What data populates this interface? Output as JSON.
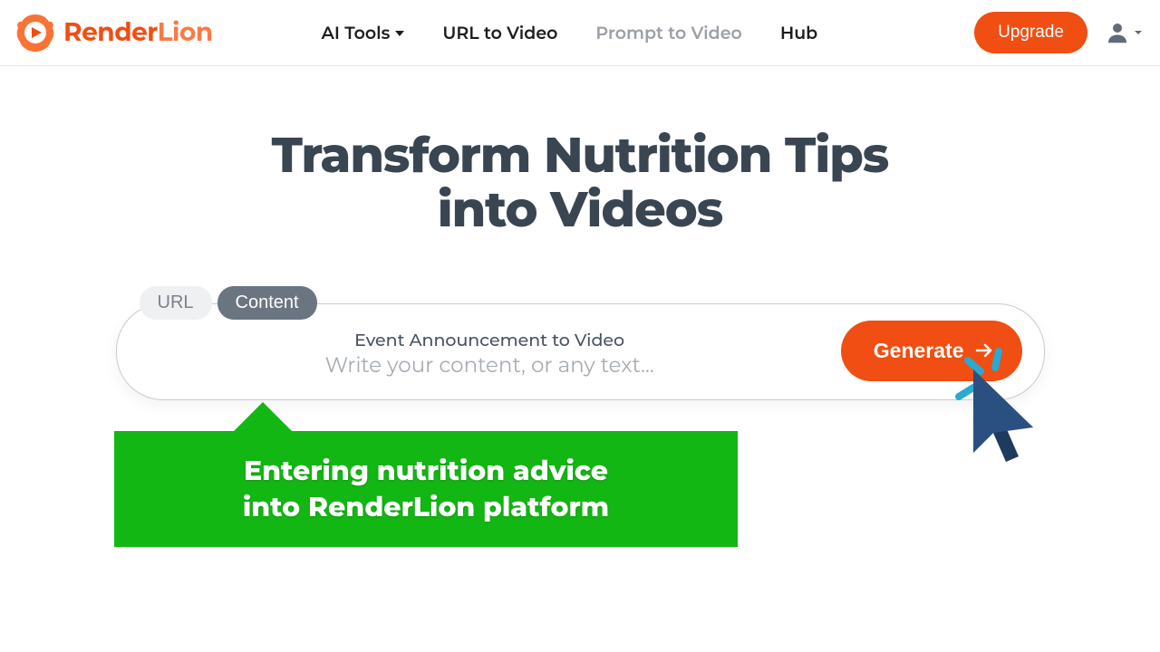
{
  "brand": {
    "name_a": "Render",
    "name_b": "Lion"
  },
  "nav": {
    "ai_tools": "AI Tools",
    "url_to_video": "URL to Video",
    "prompt_to_video": "Prompt to Video",
    "hub": "Hub"
  },
  "header": {
    "upgrade": "Upgrade"
  },
  "hero": {
    "title_line1": "Transform Nutrition Tips",
    "title_line2": "into Videos"
  },
  "tabs": {
    "url": "URL",
    "content": "Content"
  },
  "input": {
    "label": "Event Announcement to Video",
    "placeholder": "Write your content, or any text..."
  },
  "generate": {
    "label": "Generate"
  },
  "callout": {
    "line1": "Entering nutrition advice",
    "line2": "into RenderLion platform"
  },
  "colors": {
    "accent": "#f04e12",
    "callout": "#13b713",
    "text_dark": "#3a4552"
  }
}
